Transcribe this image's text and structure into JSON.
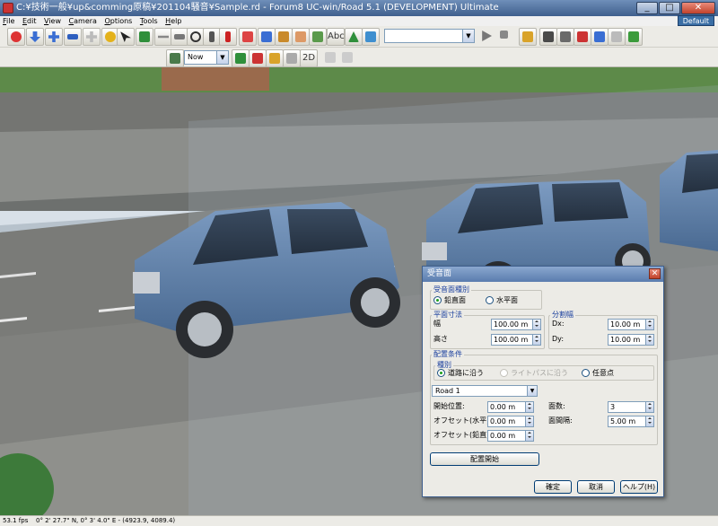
{
  "window": {
    "title": "C:¥技術一般¥up&comming原稿¥201104騒音¥Sample.rd - Forum8 UC-win/Road 5.1 (DEVELOPMENT) Ultimate",
    "default_label": "Default"
  },
  "menu": [
    "File",
    "Edit",
    "View",
    "Camera",
    "Options",
    "Tools",
    "Help"
  ],
  "toolbar": {
    "time_select": "Now",
    "view_mode": "2D",
    "main_icons": [
      "rotate-icon",
      "move-down-icon",
      "move-cross-icon",
      "fly-icon",
      "walk-icon",
      "pick-icon",
      "cursor-icon",
      "drive-icon",
      "airplane-icon",
      "car-icon",
      "steering-wheel-icon",
      "person-icon",
      "person-red-icon",
      "road-icon",
      "building-icon",
      "tree-icon",
      "model-icon",
      "text-icon",
      "forest-icon",
      "image-icon",
      "edit-icon",
      "scene-icon",
      "terrain-icon",
      "signal-icon",
      "sign-icon",
      "document-icon",
      "add-icon"
    ],
    "sub_icons": [
      "environment-icon",
      "weather-sun-icon",
      "traffic-icon",
      "flag-icon",
      "fog-icon",
      "rain-icon",
      "sound-icon",
      "graph-icon"
    ]
  },
  "status": {
    "fps": "53.1 fps",
    "coords": "0°  2' 27.7\" N, 0°  3' 4.0\" E  -  (4923.9, 4089.4)"
  },
  "colors": {
    "titlebar": "#4e6f9e",
    "car_body": "#5b7ea6",
    "road": "#7a7b78",
    "dialog_bg": "#ecebe6",
    "group_label": "#1a3f9e"
  },
  "dialog": {
    "title": "受音面",
    "type_group": "受音面種別",
    "type_options": [
      "鉛直面",
      "水平面"
    ],
    "type_selected": "鉛直面",
    "size_group": "平面寸法",
    "width_label": "幅",
    "width_value": "100.00 m",
    "height_label": "高さ",
    "height_value": "100.00 m",
    "div_group": "分割幅",
    "dx_label": "Dx:",
    "dx_value": "10.00 m",
    "dy_label": "Dy:",
    "dy_value": "10.00 m",
    "place_group": "配置条件",
    "kind_group": "種別",
    "kind_options": [
      "道路に沿う",
      "ライトパスに沿う",
      "任意点"
    ],
    "kind_selected": "道路に沿う",
    "road_select": "Road 1",
    "start_label": "開始位置:",
    "start_value": "0.00 m",
    "offset_h_label": "オフセット(水平):",
    "offset_h_value": "0.00 m",
    "offset_v_label": "オフセット(鉛直):",
    "offset_v_value": "0.00 m",
    "count_label": "面数:",
    "count_value": "3",
    "interval_label": "面間隔:",
    "interval_value": "5.00 m",
    "place_button": "配置開始",
    "ok_button": "確定",
    "cancel_button": "取消",
    "help_button": "ヘルプ(H)"
  }
}
